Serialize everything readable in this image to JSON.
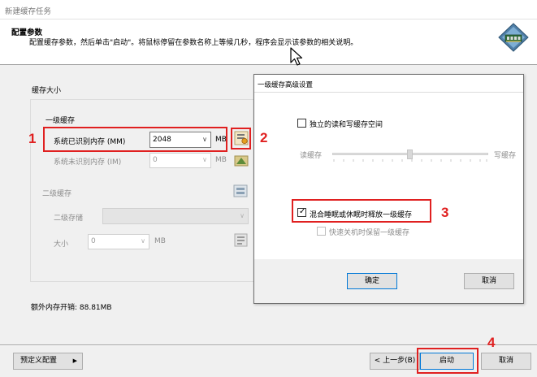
{
  "window": {
    "title": "新建缓存任务"
  },
  "header": {
    "title": "配置参数",
    "description": "配置缓存参数，然后单击\"启动\"。将鼠标停留在参数名称上等候几秒，程序会显示该参数的相关说明。"
  },
  "cache_size": {
    "group_label": "缓存大小",
    "level1": {
      "label": "一级缓存",
      "recognized_memory_label": "系统已识别内存 (MM)",
      "recognized_memory_value": "2048",
      "recognized_memory_unit": "MB",
      "unrecognized_memory_label": "系统未识别内存 (IM)",
      "unrecognized_memory_value": "0",
      "unrecognized_memory_unit": "MB"
    },
    "level2": {
      "label": "二级缓存",
      "storage_label": "二级存储",
      "storage_value": "",
      "size_label": "大小",
      "size_value": "0",
      "size_unit": "MB"
    }
  },
  "extra_memory": {
    "text": "额外内存开销: 88.81MB"
  },
  "footer": {
    "predefined_button": "预定义配置",
    "predefined_arrow": "▶",
    "back_button": "< 上一步(B)",
    "start_button": "启动",
    "cancel_button": "取消"
  },
  "advanced_dialog": {
    "title": "一级缓存高级设置",
    "independent_rw_label": "独立的读和写缓存空间",
    "independent_rw_checked": false,
    "read_cache_label": "读缓存",
    "write_cache_label": "写缓存",
    "hybrid_sleep_label": "混合睡眠或休眠时释放一级缓存",
    "hybrid_sleep_checked": true,
    "fast_shutdown_label": "快速关机时保留一级缓存",
    "fast_shutdown_checked": false,
    "ok_button": "确定",
    "cancel_button": "取消"
  },
  "annotations": {
    "step1": "1",
    "step2": "2",
    "step3": "3",
    "step4": "4"
  },
  "colors": {
    "annotation_red": "#e02020",
    "button_focus_blue": "#0078d7"
  },
  "icons": {
    "app_logo": "memory-chip-app-icon",
    "cursor": "mouse-pointer-icon",
    "level1_settings": "advanced-settings-icon",
    "im_settings": "advanced-settings-icon",
    "level2_settings": "storage-settings-icon",
    "size_settings": "settings-icon"
  }
}
